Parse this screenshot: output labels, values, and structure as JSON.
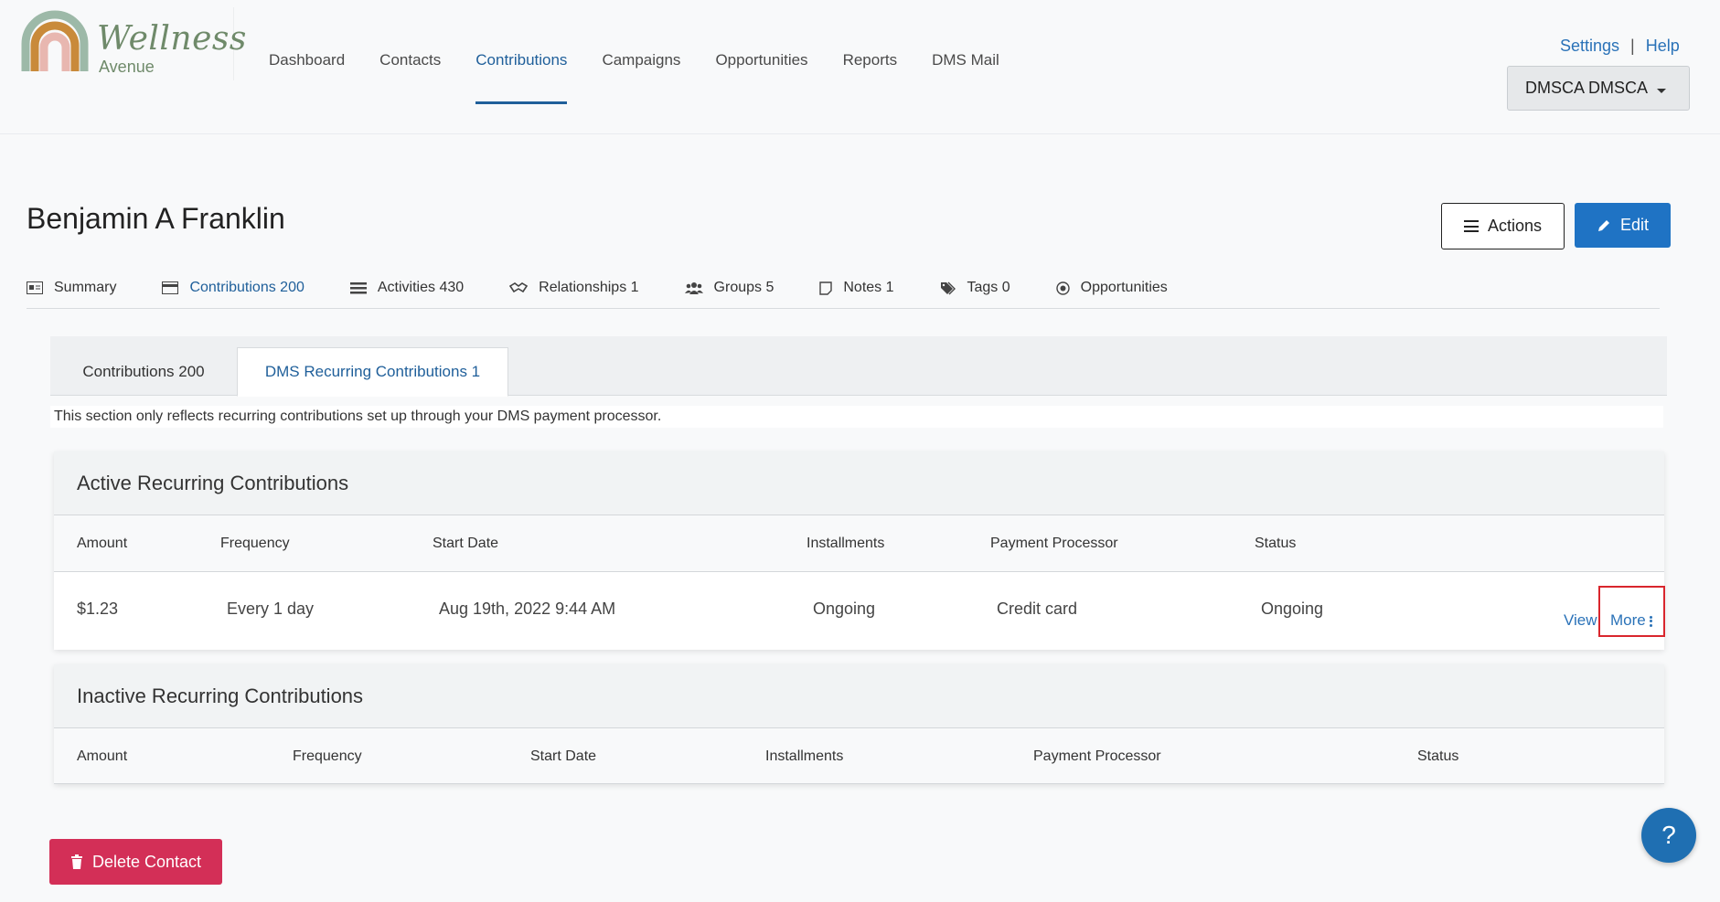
{
  "brand": {
    "name": "Wellness",
    "sub": "Avenue"
  },
  "nav": {
    "items": [
      {
        "label": "Dashboard",
        "active": false
      },
      {
        "label": "Contacts",
        "active": false
      },
      {
        "label": "Contributions",
        "active": true
      },
      {
        "label": "Campaigns",
        "active": false
      },
      {
        "label": "Opportunities",
        "active": false
      },
      {
        "label": "Reports",
        "active": false
      },
      {
        "label": "DMS Mail",
        "active": false
      }
    ]
  },
  "toplinks": {
    "settings": "Settings",
    "separator": "|",
    "help": "Help"
  },
  "user": {
    "name": "DMSCA DMSCA"
  },
  "contact": {
    "name": "Benjamin A Franklin"
  },
  "buttons": {
    "actions": "Actions",
    "edit": "Edit",
    "delete": "Delete Contact",
    "help_fab": "?"
  },
  "subtabs": [
    {
      "label": "Summary",
      "icon": "id-card-icon"
    },
    {
      "label": "Contributions 200",
      "icon": "credit-card-icon",
      "active": true
    },
    {
      "label": "Activities 430",
      "icon": "list-icon"
    },
    {
      "label": "Relationships 1",
      "icon": "handshake-icon"
    },
    {
      "label": "Groups 5",
      "icon": "users-icon"
    },
    {
      "label": "Notes 1",
      "icon": "note-icon"
    },
    {
      "label": "Tags 0",
      "icon": "tags-icon"
    },
    {
      "label": "Opportunities",
      "icon": "target-icon"
    }
  ],
  "inner_tabs": [
    {
      "label": "Contributions 200"
    },
    {
      "label": "DMS Recurring Contributions 1",
      "active": true
    }
  ],
  "note": "This section only reflects recurring contributions set up through your DMS payment processor.",
  "active_section": {
    "title": "Active Recurring Contributions",
    "columns": [
      "Amount",
      "Frequency",
      "Start Date",
      "Installments",
      "Payment Processor",
      "Status"
    ],
    "rows": [
      {
        "amount": "$1.23",
        "frequency": "Every 1 day",
        "start_date": "Aug 19th, 2022 9:44 AM",
        "installments": "Ongoing",
        "processor": "Credit card",
        "status": "Ongoing",
        "view": "View",
        "more": "More"
      }
    ]
  },
  "inactive_section": {
    "title": "Inactive Recurring Contributions",
    "columns": [
      "Amount",
      "Frequency",
      "Start Date",
      "Installments",
      "Payment Processor",
      "Status"
    ]
  },
  "colors": {
    "accent": "#1f73c4",
    "danger": "#d32f57",
    "highlight": "#d9262d"
  }
}
